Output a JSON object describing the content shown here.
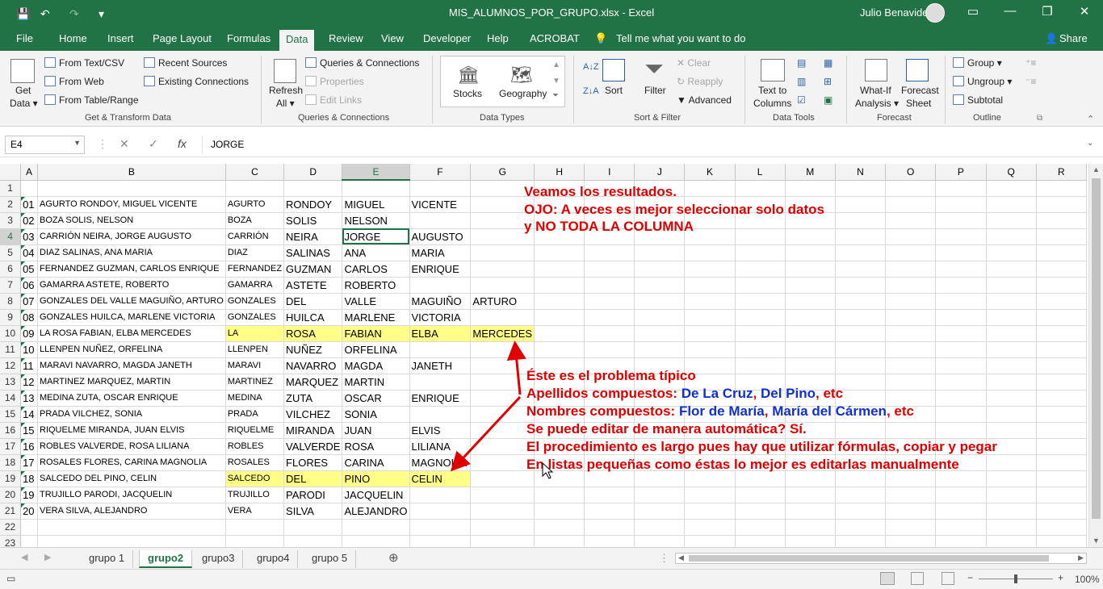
{
  "titlebar": {
    "doc_title": "MIS_ALUMNOS_POR_GRUPO.xlsx  -  Excel",
    "user": "Julio Benavides",
    "save_icon": "💾",
    "undo_icon": "↶",
    "redo_icon": "↷",
    "customize_icon": "▾",
    "ribbon_display_icon": "▭",
    "minimize_icon": "—",
    "restore_icon": "❐",
    "close_icon": "✕"
  },
  "tabs": [
    "File",
    "Home",
    "Insert",
    "Page Layout",
    "Formulas",
    "Data",
    "Review",
    "View",
    "Developer",
    "Help",
    "ACROBAT"
  ],
  "tell_me": "Tell me what you want to do",
  "share": "Share",
  "ribbon": {
    "get_data": "Get",
    "get_data2": "Data ▾",
    "from_text_csv": "From Text/CSV",
    "from_web": "From Web",
    "from_table": "From Table/Range",
    "recent_sources": "Recent Sources",
    "existing_connections": "Existing Connections",
    "group_get_transform": "Get & Transform Data",
    "refresh": "Refresh",
    "refresh2": "All ▾",
    "queries_connections": "Queries & Connections",
    "properties": "Properties",
    "edit_links": "Edit Links",
    "group_queries": "Queries & Connections",
    "stocks": "Stocks",
    "geography": "Geography",
    "group_data_types": "Data Types",
    "sort_az": "A↓Z",
    "sort_za": "Z↓A",
    "sort": "Sort",
    "filter": "Filter",
    "clear": "Clear",
    "reapply": "Reapply",
    "advanced": "Advanced",
    "group_sort_filter": "Sort & Filter",
    "text_to_columns": "Text to",
    "text_to_columns2": "Columns",
    "group_data_tools": "Data Tools",
    "what_if": "What-If",
    "what_if2": "Analysis ▾",
    "forecast_sheet": "Forecast",
    "forecast_sheet2": "Sheet",
    "group_forecast": "Forecast",
    "group": "Group",
    "ungroup": "Ungroup",
    "subtotal": "Subtotal",
    "group_outline": "Outline"
  },
  "formula_bar": {
    "name_box": "E4",
    "content": "JORGE"
  },
  "columns": [
    "A",
    "B",
    "C",
    "D",
    "E",
    "F",
    "G",
    "H",
    "I",
    "J",
    "K",
    "L",
    "M",
    "N",
    "O",
    "P",
    "Q",
    "R"
  ],
  "rows": [
    {
      "n": "1",
      "a": "",
      "b": "",
      "c": "",
      "d": "",
      "e": "",
      "f": "",
      "g": ""
    },
    {
      "n": "2",
      "a": "01",
      "b": "AGURTO RONDOY, MIGUEL VICENTE",
      "c": "AGURTO",
      "d": "RONDOY",
      "e": "MIGUEL",
      "f": "VICENTE",
      "g": ""
    },
    {
      "n": "3",
      "a": "02",
      "b": "BOZA SOLIS, NELSON",
      "c": "BOZA",
      "d": "SOLIS",
      "e": "NELSON",
      "f": "",
      "g": ""
    },
    {
      "n": "4",
      "a": "03",
      "b": "CARRIÓN NEIRA, JORGE AUGUSTO",
      "c": "CARRIÓN",
      "d": "NEIRA",
      "e": "JORGE",
      "f": "AUGUSTO",
      "g": ""
    },
    {
      "n": "5",
      "a": "04",
      "b": "DIAZ SALINAS, ANA MARIA",
      "c": "DIAZ",
      "d": "SALINAS",
      "e": "ANA",
      "f": "MARIA",
      "g": ""
    },
    {
      "n": "6",
      "a": "05",
      "b": "FERNANDEZ GUZMAN, CARLOS ENRIQUE",
      "c": "FERNANDEZ",
      "d": "GUZMAN",
      "e": "CARLOS",
      "f": "ENRIQUE",
      "g": ""
    },
    {
      "n": "7",
      "a": "06",
      "b": "GAMARRA ASTETE, ROBERTO",
      "c": "GAMARRA",
      "d": "ASTETE",
      "e": "ROBERTO",
      "f": "",
      "g": ""
    },
    {
      "n": "8",
      "a": "07",
      "b": "GONZALES DEL VALLE MAGUIÑO, ARTURO",
      "c": "GONZALES",
      "d": "DEL",
      "e": "VALLE",
      "f": "MAGUIÑO",
      "g": "ARTURO"
    },
    {
      "n": "9",
      "a": "08",
      "b": "GONZALES HUILCA, MARLENE VICTORIA",
      "c": "GONZALES",
      "d": "HUILCA",
      "e": "MARLENE",
      "f": "VICTORIA",
      "g": ""
    },
    {
      "n": "10",
      "a": "09",
      "b": "LA ROSA FABIAN, ELBA MERCEDES",
      "c": "LA",
      "d": "ROSA",
      "e": "FABIAN",
      "f": "ELBA",
      "g": "MERCEDES"
    },
    {
      "n": "11",
      "a": "10",
      "b": "LLENPEN NUÑEZ, ORFELINA",
      "c": "LLENPEN",
      "d": "NUÑEZ",
      "e": "ORFELINA",
      "f": "",
      "g": ""
    },
    {
      "n": "12",
      "a": "11",
      "b": "MARAVI NAVARRO, MAGDA JANETH",
      "c": "MARAVI",
      "d": "NAVARRO",
      "e": "MAGDA",
      "f": "JANETH",
      "g": ""
    },
    {
      "n": "13",
      "a": "12",
      "b": "MARTINEZ MARQUEZ, MARTIN",
      "c": "MARTINEZ",
      "d": "MARQUEZ",
      "e": "MARTIN",
      "f": "",
      "g": ""
    },
    {
      "n": "14",
      "a": "13",
      "b": "MEDINA ZUTA, OSCAR ENRIQUE",
      "c": "MEDINA",
      "d": "ZUTA",
      "e": "OSCAR",
      "f": "ENRIQUE",
      "g": ""
    },
    {
      "n": "15",
      "a": "14",
      "b": "PRADA VILCHEZ, SONIA",
      "c": "PRADA",
      "d": "VILCHEZ",
      "e": "SONIA",
      "f": "",
      "g": ""
    },
    {
      "n": "16",
      "a": "15",
      "b": "RIQUELME MIRANDA, JUAN ELVIS",
      "c": "RIQUELME",
      "d": "MIRANDA",
      "e": "JUAN",
      "f": "ELVIS",
      "g": ""
    },
    {
      "n": "17",
      "a": "16",
      "b": "ROBLES VALVERDE, ROSA LILIANA",
      "c": "ROBLES",
      "d": "VALVERDE",
      "e": "ROSA",
      "f": "LILIANA",
      "g": ""
    },
    {
      "n": "18",
      "a": "17",
      "b": "ROSALES FLORES, CARINA MAGNOLIA",
      "c": "ROSALES",
      "d": "FLORES",
      "e": "CARINA",
      "f": "MAGNOLIA",
      "g": ""
    },
    {
      "n": "19",
      "a": "18",
      "b": "SALCEDO DEL PINO, CELIN",
      "c": "SALCEDO",
      "d": "DEL",
      "e": "PINO",
      "f": "CELIN",
      "g": ""
    },
    {
      "n": "20",
      "a": "19",
      "b": "TRUJILLO PARODI, JACQUELIN",
      "c": "TRUJILLO",
      "d": "PARODI",
      "e": "JACQUELIN",
      "f": "",
      "g": ""
    },
    {
      "n": "21",
      "a": "20",
      "b": "VERA SILVA, ALEJANDRO",
      "c": "VERA",
      "d": "SILVA",
      "e": "ALEJANDRO",
      "f": "",
      "g": ""
    },
    {
      "n": "22",
      "a": "",
      "b": "",
      "c": "",
      "d": "",
      "e": "",
      "f": "",
      "g": ""
    },
    {
      "n": "23",
      "a": "",
      "b": "",
      "c": "",
      "d": "",
      "e": "",
      "f": "",
      "g": ""
    }
  ],
  "annotation_top": [
    "Veamos los resultados.",
    "OJO: A veces es mejor seleccionar solo datos",
    "y NO TODA LA COLUMNA"
  ],
  "annotation_bottom": {
    "line1": "Éste es el problema típico",
    "line2a": "Apellidos compuestos: ",
    "line2b": "De La Cruz",
    "line2c": ", ",
    "line2d": "Del Pino",
    "line2e": ", etc",
    "line3a": "Nombres compuestos: ",
    "line3b": "Flor de María",
    "line3c": ", ",
    "line3d": "María del Cármen",
    "line3e": ", etc",
    "line4": "Se puede editar de manera automática? Sí.",
    "line5": "El procedimiento es largo pues hay que utilizar fórmulas, copiar y pegar",
    "line6": "En listas pequeñas como éstas lo mejor es editarlas manualmente"
  },
  "sheets": [
    "grupo 1",
    "grupo2",
    "grupo3",
    "grupo4",
    "grupo 5"
  ],
  "active_sheet": "grupo2",
  "zoom": "100%",
  "colors": {
    "excel_green": "#217346",
    "highlight": "#ffff88",
    "annotation_red": "#e00000",
    "annotation_blue": "#1030d0"
  }
}
